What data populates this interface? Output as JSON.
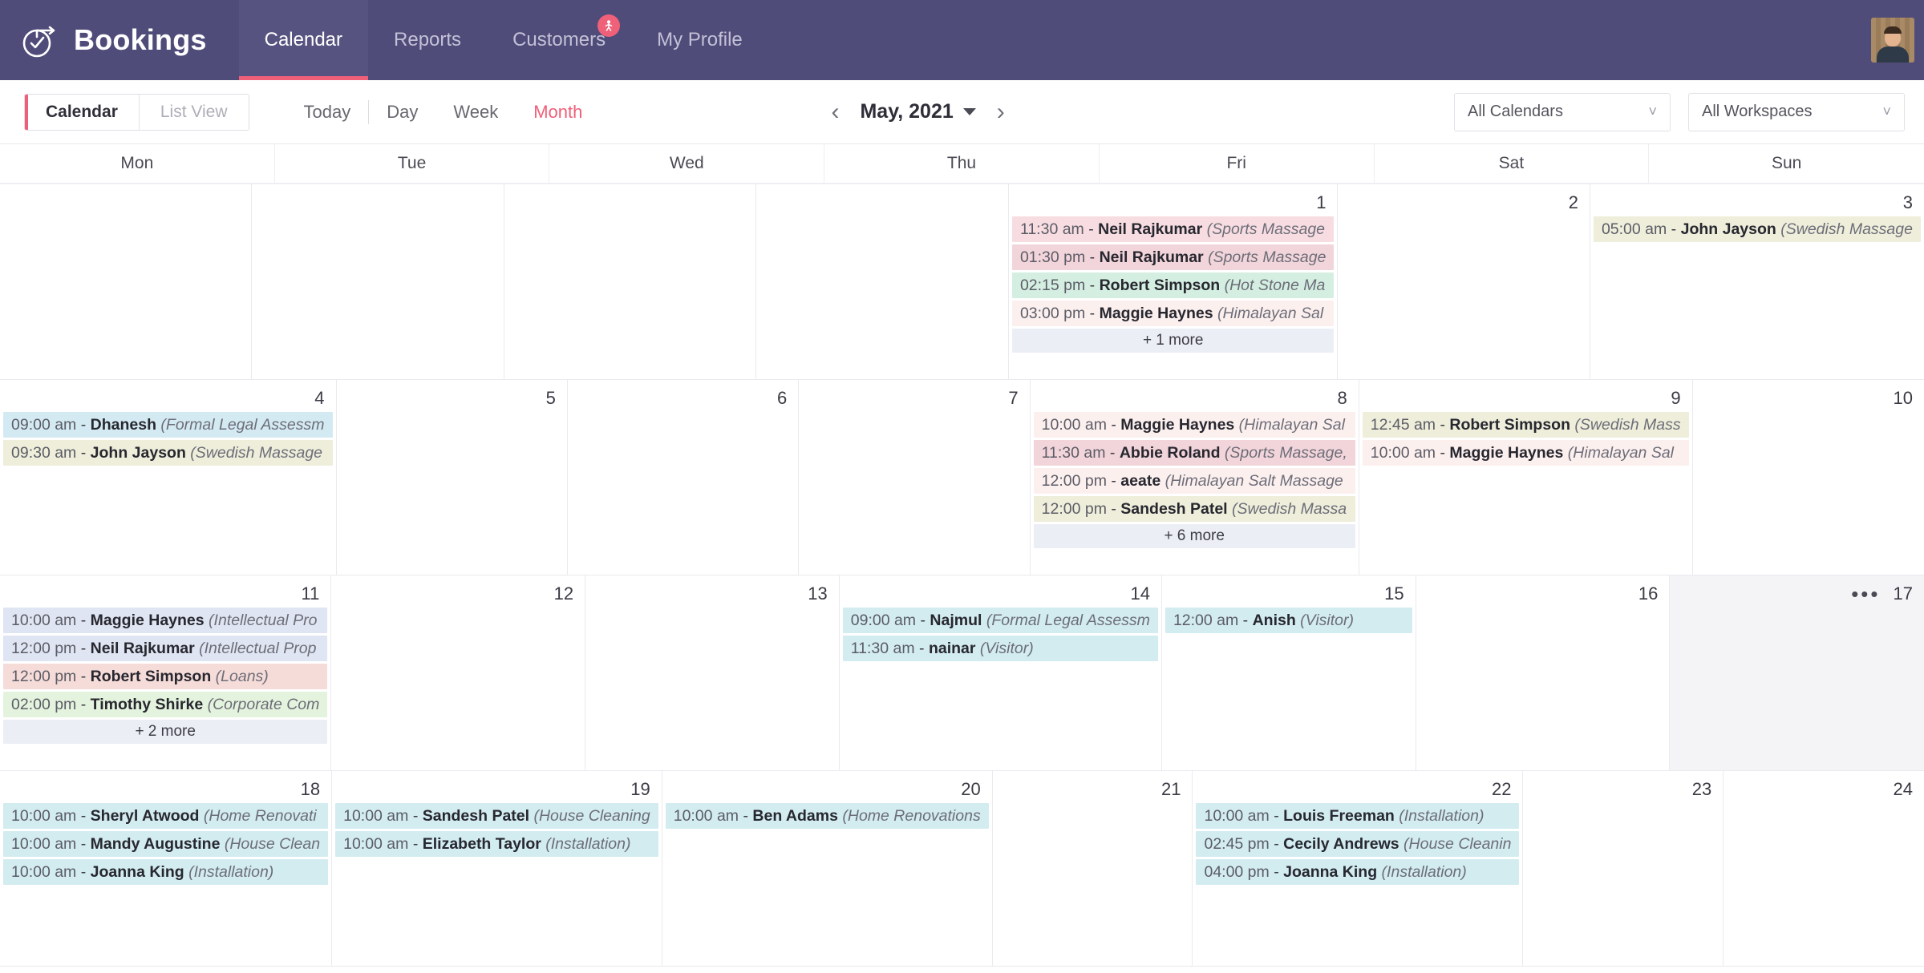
{
  "app": {
    "brand": "Bookings",
    "nav": [
      {
        "label": "Calendar",
        "active": true,
        "badge": false
      },
      {
        "label": "Reports",
        "active": false,
        "badge": false
      },
      {
        "label": "Customers",
        "active": false,
        "badge": true
      },
      {
        "label": "My Profile",
        "active": false,
        "badge": false
      }
    ],
    "badge_icon": "person-icon",
    "logo_icon": "clock-check-icon",
    "avatar_alt": "user-avatar"
  },
  "toolbar": {
    "view_calendar": "Calendar",
    "view_list": "List View",
    "today": "Today",
    "day": "Day",
    "week": "Week",
    "month": "Month",
    "active_range": "Month",
    "prev_icon": "chevron-left-icon",
    "next_icon": "chevron-right-icon",
    "month_label": "May, 2021",
    "calendar_select": "All Calendars",
    "workspace_select": "All Workspaces"
  },
  "calendar": {
    "weekdays": [
      "Mon",
      "Tue",
      "Wed",
      "Thu",
      "Fri",
      "Sat",
      "Sun"
    ],
    "weeks": [
      [
        {
          "day": "",
          "events": []
        },
        {
          "day": "",
          "events": []
        },
        {
          "day": "",
          "events": []
        },
        {
          "day": "",
          "events": []
        },
        {
          "day": "1",
          "events": [
            {
              "time": "11:30 am",
              "name": "Neil Rajkumar",
              "service": "(Sports Massage",
              "color": "c-pink"
            },
            {
              "time": "01:30 pm",
              "name": "Neil Rajkumar",
              "service": "(Sports Massage",
              "color": "c-rose"
            },
            {
              "time": "02:15 pm",
              "name": "Robert Simpson",
              "service": "(Hot Stone Ma",
              "color": "c-mint"
            },
            {
              "time": "03:00 pm",
              "name": "Maggie Haynes",
              "service": "(Himalayan Sal",
              "color": "c-blush"
            }
          ],
          "more": "+ 1 more"
        },
        {
          "day": "2",
          "events": []
        },
        {
          "day": "3",
          "events": [
            {
              "time": "05:00 am",
              "name": "John Jayson",
              "service": "(Swedish Massage",
              "color": "c-cream"
            }
          ]
        }
      ],
      [
        {
          "day": "4",
          "events": [
            {
              "time": "09:00 am",
              "name": "Dhanesh",
              "service": "(Formal Legal Assessm",
              "color": "c-sky"
            },
            {
              "time": "09:30 am",
              "name": "John Jayson",
              "service": "(Swedish Massage",
              "color": "c-cream"
            }
          ]
        },
        {
          "day": "5",
          "events": []
        },
        {
          "day": "6",
          "events": []
        },
        {
          "day": "7",
          "events": []
        },
        {
          "day": "8",
          "events": [
            {
              "time": "10:00 am",
              "name": "Maggie Haynes",
              "service": "(Himalayan Sal",
              "color": "c-blush"
            },
            {
              "time": "11:30 am",
              "name": "Abbie Roland",
              "service": "(Sports Massage,",
              "color": "c-rose"
            },
            {
              "time": "12:00 pm",
              "name": "aeate",
              "service": "(Himalayan Salt Massage",
              "color": "c-blush"
            },
            {
              "time": "12:00 pm",
              "name": "Sandesh Patel",
              "service": "(Swedish Massa",
              "color": "c-cream"
            }
          ],
          "more": "+ 6 more"
        },
        {
          "day": "9",
          "events": [
            {
              "time": "12:45 am",
              "name": "Robert Simpson",
              "service": "(Swedish Mass",
              "color": "c-cream"
            },
            {
              "time": "10:00 am",
              "name": "Maggie Haynes",
              "service": "(Himalayan Sal",
              "color": "c-blush"
            }
          ]
        },
        {
          "day": "10",
          "events": []
        }
      ],
      [
        {
          "day": "11",
          "events": [
            {
              "time": "10:00 am",
              "name": "Maggie Haynes",
              "service": "(Intellectual Pro",
              "color": "c-blue"
            },
            {
              "time": "12:00 pm",
              "name": "Neil Rajkumar",
              "service": "(Intellectual Prop",
              "color": "c-blue"
            },
            {
              "time": "12:00 pm",
              "name": "Robert Simpson",
              "service": "(Loans)",
              "color": "c-lred"
            },
            {
              "time": "02:00 pm",
              "name": "Timothy Shirke",
              "service": "(Corporate Com",
              "color": "c-green"
            }
          ],
          "more": "+ 2 more"
        },
        {
          "day": "12",
          "events": []
        },
        {
          "day": "13",
          "events": []
        },
        {
          "day": "14",
          "events": [
            {
              "time": "09:00 am",
              "name": "Najmul",
              "service": "(Formal Legal Assessm",
              "color": "c-cyan"
            },
            {
              "time": "11:30 am",
              "name": "nainar",
              "service": "(Visitor)",
              "color": "c-cyan"
            }
          ]
        },
        {
          "day": "15",
          "events": [
            {
              "time": "12:00 am",
              "name": "Anish",
              "service": "(Visitor)",
              "color": "c-cyan"
            }
          ]
        },
        {
          "day": "16",
          "events": []
        },
        {
          "day": "17",
          "events": [],
          "highlight": true,
          "menu": "•••"
        }
      ],
      [
        {
          "day": "18",
          "events": [
            {
              "time": "10:00 am",
              "name": "Sheryl Atwood",
              "service": "(Home Renovati",
              "color": "c-cyan"
            },
            {
              "time": "10:00 am",
              "name": "Mandy Augustine",
              "service": "(House Clean",
              "color": "c-cyan"
            },
            {
              "time": "10:00 am",
              "name": "Joanna King",
              "service": "(Installation)",
              "color": "c-cyan"
            }
          ]
        },
        {
          "day": "19",
          "events": [
            {
              "time": "10:00 am",
              "name": "Sandesh Patel",
              "service": "(House Cleaning",
              "color": "c-cyan"
            },
            {
              "time": "10:00 am",
              "name": "Elizabeth Taylor",
              "service": "(Installation)",
              "color": "c-cyan"
            }
          ]
        },
        {
          "day": "20",
          "events": [
            {
              "time": "10:00 am",
              "name": "Ben Adams",
              "service": "(Home Renovations",
              "color": "c-cyan"
            }
          ]
        },
        {
          "day": "21",
          "events": []
        },
        {
          "day": "22",
          "events": [
            {
              "time": "10:00 am",
              "name": "Louis Freeman",
              "service": "(Installation)",
              "color": "c-cyan"
            },
            {
              "time": "02:45 pm",
              "name": "Cecily Andrews",
              "service": "(House Cleanin",
              "color": "c-cyan"
            },
            {
              "time": "04:00 pm",
              "name": "Joanna King",
              "service": "(Installation)",
              "color": "c-cyan"
            }
          ]
        },
        {
          "day": "23",
          "events": []
        },
        {
          "day": "24",
          "events": []
        }
      ]
    ]
  },
  "colors": {
    "brand_bg": "#4f4c7a",
    "accent": "#ef5f78",
    "nav_active_bg": "#565380"
  }
}
